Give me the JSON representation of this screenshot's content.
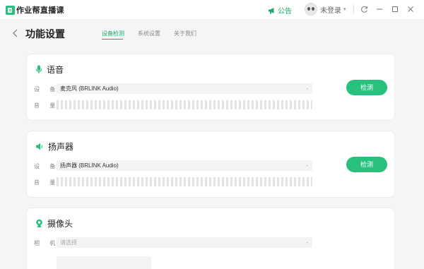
{
  "app": {
    "name": "作业帮直播课",
    "notice_label": "公告",
    "user_label": "未登录"
  },
  "colors": {
    "accent": "#27c07c",
    "accent_text": "#1aaa6a",
    "background": "#f4f5f7"
  },
  "page": {
    "title": "功能设置",
    "tabs": [
      {
        "label": "设备检测",
        "active": true
      },
      {
        "label": "系统设置",
        "active": false
      },
      {
        "label": "关于我们",
        "active": false
      }
    ]
  },
  "sections": {
    "voice": {
      "title": "语音",
      "icon": "microphone-icon",
      "device_label": "设 备",
      "device_value": "麦克风 (BRLINK Audio)",
      "volume_label": "音 量",
      "button": "检测"
    },
    "speaker": {
      "title": "扬声器",
      "icon": "speaker-icon",
      "device_label": "设 备",
      "device_value": "扬声器 (BRLINK Audio)",
      "volume_label": "音 量",
      "button": "检测"
    },
    "camera": {
      "title": "摄像头",
      "icon": "camera-icon",
      "device_label": "相 机",
      "device_placeholder": "请选择"
    }
  }
}
